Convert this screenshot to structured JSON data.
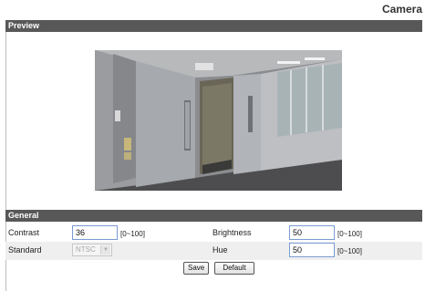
{
  "header": {
    "title": "Camera"
  },
  "preview": {
    "section_title": "Preview"
  },
  "general": {
    "section_title": "General",
    "contrast": {
      "label": "Contrast",
      "value": "36",
      "range": "[0~100]"
    },
    "brightness": {
      "label": "Brightness",
      "value": "50",
      "range": "[0~100]"
    },
    "standard": {
      "label": "Standard",
      "selected": "NTSC"
    },
    "hue": {
      "label": "Hue",
      "value": "50",
      "range": "[0~100]"
    }
  },
  "actions": {
    "save_label": "Save",
    "default_label": "Default"
  }
}
